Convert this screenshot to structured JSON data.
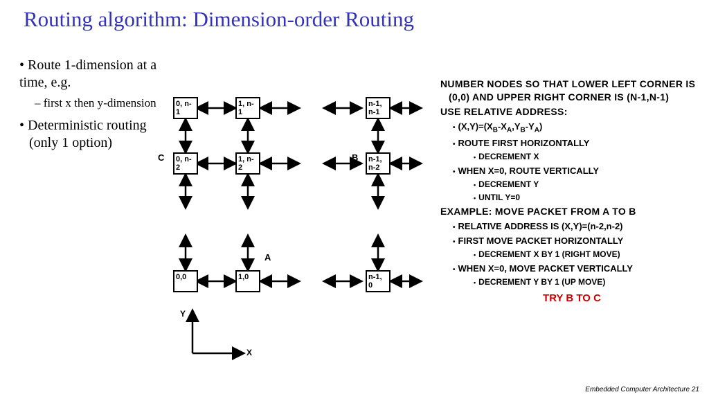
{
  "title": "Routing algorithm: Dimension-order Routing",
  "left": {
    "b1": "Route 1-dimension at a time, e.g.",
    "s1": "first x then y-dimension",
    "b2": "Deterministic routing",
    "b2b": "(only 1 option)"
  },
  "diagram": {
    "nodes": {
      "tl": "0, n-1",
      "tm": "1, n-1",
      "tr": "n-1, n-1",
      "ml": "0, n-2",
      "mm": "1, n-2",
      "mr": "n-1, n-2",
      "bl": "0,0",
      "bm": "1,0",
      "br": "n-1, 0"
    },
    "labels": {
      "A": "A",
      "B": "B",
      "C": "C",
      "X": "X",
      "Y": "Y"
    }
  },
  "right": {
    "h1": "NUMBER NODES SO THAT LOWER LEFT CORNER IS (0,0) AND UPPER RIGHT CORNER IS (N-1,N-1)",
    "h2": "USE RELATIVE ADDRESS:",
    "rel_addr_plain": "(X,Y)=(XB-XA,YB-YA)",
    "b1b": "ROUTE FIRST HORIZONTALLY",
    "b2a": "DECREMENT X",
    "b1c": "WHEN X=0, ROUTE VERTICALLY",
    "b2b": "DECREMENT Y",
    "b2c": "UNTIL Y=0",
    "h3": "EXAMPLE: MOVE PACKET FROM A TO B",
    "e1": "RELATIVE ADDRESS IS (X,Y)=(n-2,n-2)",
    "e2": "FIRST MOVE PACKET HORIZONTALLY",
    "e2a": "DECREMENT X BY 1 (RIGHT MOVE)",
    "e3": "WHEN X=0, MOVE PACKET VERTICALLY",
    "e3a": "DECREMENT Y BY 1 (UP MOVE)",
    "try": "TRY B TO C"
  },
  "footer": "Embedded Computer Architecture  21"
}
